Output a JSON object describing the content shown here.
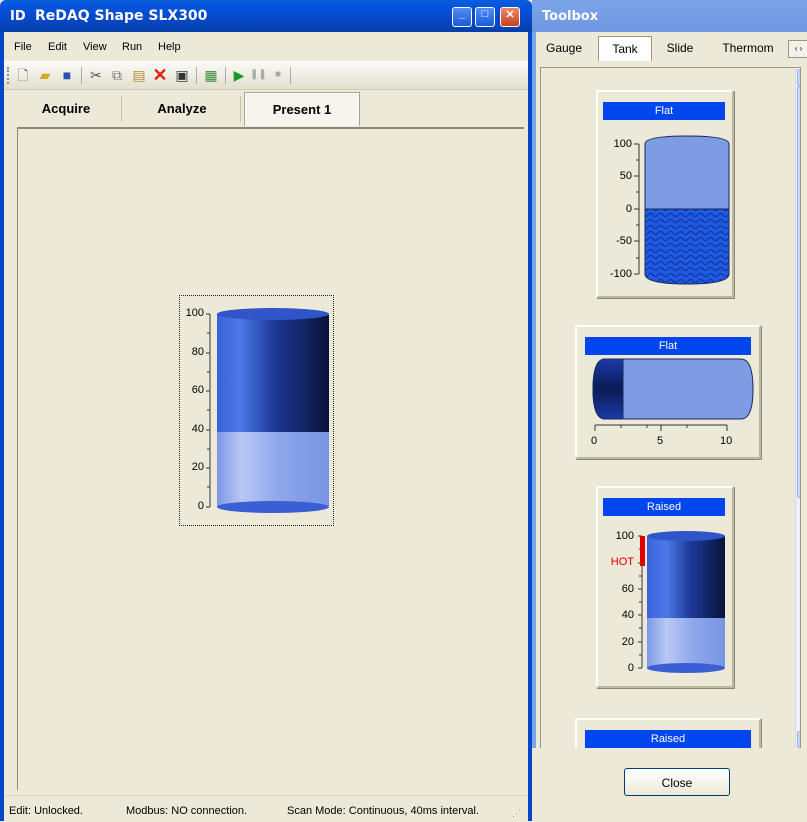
{
  "app": {
    "logo": "ID",
    "title": "ReDAQ Shape SLX300"
  },
  "window_buttons": {
    "minimize": "_",
    "maximize": "□",
    "close": "✕"
  },
  "menu": [
    "File",
    "Edit",
    "View",
    "Run",
    "Help"
  ],
  "toolbar_icons": [
    "new-icon",
    "open-icon",
    "save-icon",
    "cut-icon",
    "copy-icon",
    "paste-icon",
    "delete-icon",
    "properties-icon",
    "picture-icon",
    "run-icon",
    "pause-icon",
    "stop-icon"
  ],
  "tabs": [
    "Acquire",
    "Analyze",
    "Present 1"
  ],
  "main_tank": {
    "ticks": [
      "100",
      "80",
      "60",
      "40",
      "20",
      "0"
    ],
    "level": 0.35
  },
  "status": {
    "edit": "Edit: Unlocked.",
    "modbus": "Modbus: NO connection.",
    "scan": "Scan Mode: Continuous, 40ms interval."
  },
  "toolbox": {
    "title": "Toolbox",
    "tabs": [
      "Gauge",
      "Tank",
      "Slide",
      "Thermom"
    ],
    "scroll_arrows": "‹ ›",
    "items": [
      {
        "label": "Flat",
        "ticks": [
          "100",
          "50",
          "0",
          "-50",
          "-100"
        ],
        "level": 0.5
      },
      {
        "label": "Flat",
        "ticks": [
          "0",
          "5",
          "10"
        ],
        "level": 0.2
      },
      {
        "label": "Raised",
        "ticks": [
          "100",
          "HOT",
          "60",
          "40",
          "20",
          "0"
        ],
        "level": 0.35,
        "hot_color": "#e00000"
      },
      {
        "label": "Raised"
      }
    ],
    "close_label": "Close"
  },
  "colors": {
    "titlebar": "#0846c8",
    "toolbox_titlebar": "#7da5ea",
    "card_header": "#0046ee",
    "tank_fill": "#4a73e0",
    "tank_empty": "#8aa8ea"
  }
}
